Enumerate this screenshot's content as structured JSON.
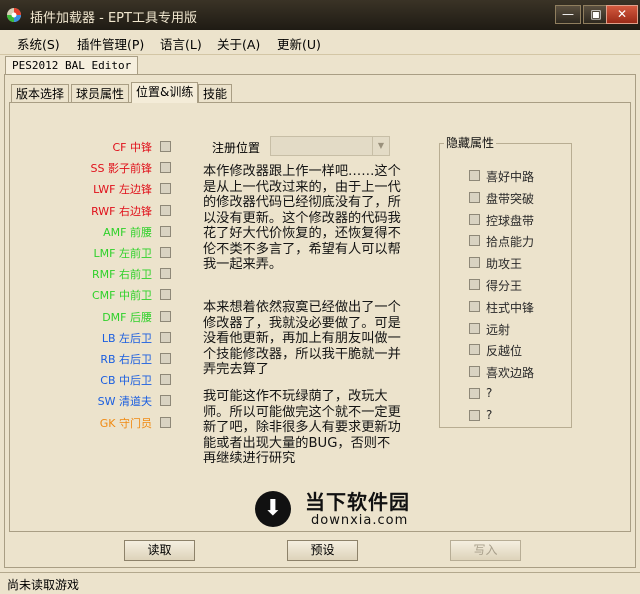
{
  "window": {
    "title": "插件加载器 - EPT工具专用版"
  },
  "menu": [
    "系统(S)",
    "插件管理(P)",
    "语言(L)",
    "关于(A)",
    "更新(U)"
  ],
  "editor_tab": "PES2012 BAL Editor",
  "tabs": [
    "版本选择",
    "球员属性",
    "位置&训练",
    "技能"
  ],
  "active_tab_index": 2,
  "positions": [
    {
      "label": "CF  中锋",
      "color": "#e0101a"
    },
    {
      "label": "SS  影子前锋",
      "color": "#e0101a"
    },
    {
      "label": "LWF  左边锋",
      "color": "#e0101a"
    },
    {
      "label": "RWF  右边锋",
      "color": "#e0101a"
    },
    {
      "label": "AMF  前腰",
      "color": "#2fd12a"
    },
    {
      "label": "LMF  左前卫",
      "color": "#2fd12a"
    },
    {
      "label": "RMF  右前卫",
      "color": "#2fd12a"
    },
    {
      "label": "CMF  中前卫",
      "color": "#2fd12a"
    },
    {
      "label": "DMF  后腰",
      "color": "#2fd12a"
    },
    {
      "label": "LB  左后卫",
      "color": "#1a5ee0"
    },
    {
      "label": "RB  右后卫",
      "color": "#1a5ee0"
    },
    {
      "label": "CB  中后卫",
      "color": "#1a5ee0"
    },
    {
      "label": "SW  清道夫",
      "color": "#1a5ee0"
    },
    {
      "label": "GK  守门员",
      "color": "#f08a12"
    }
  ],
  "registered_position": {
    "label": "注册位置",
    "value": ""
  },
  "note_paragraphs": [
    "本作修改器跟上作一样吧……这个是从上一代改过来的，由于上一代的修改器代码已经彻底没有了，所以没有更新。这个修改器的代码我花了好大代价恢复的，还恢复得不伦不类不多言了，希望有人可以帮我一起来弄。",
    "本来想着依然寂寞已经做出了一个修改器了，我就没必要做了。可是没看他更新，再加上有朋友叫做一个技能修改器，所以我干脆就一并弄完去算了",
    "我可能这作不玩绿荫了，改玩大师。所以可能做完这个就不一定更新了吧，除非很多人有要求更新功能或者出现大量的BUG，否则不再继续进行研究"
  ],
  "hidden_attributes": {
    "title": "隐藏属性",
    "items": [
      "喜好中路",
      "盘带突破",
      "控球盘带",
      "拾点能力",
      "助攻王",
      "得分王",
      "柱式中锋",
      "远射",
      "反越位",
      "喜欢边路",
      "?",
      "?"
    ]
  },
  "watermark": {
    "title": "当下软件园",
    "url": "downxia.com"
  },
  "buttons": {
    "read": "读取",
    "default": "预设",
    "write": "写入"
  },
  "status": "尚未读取游戏"
}
